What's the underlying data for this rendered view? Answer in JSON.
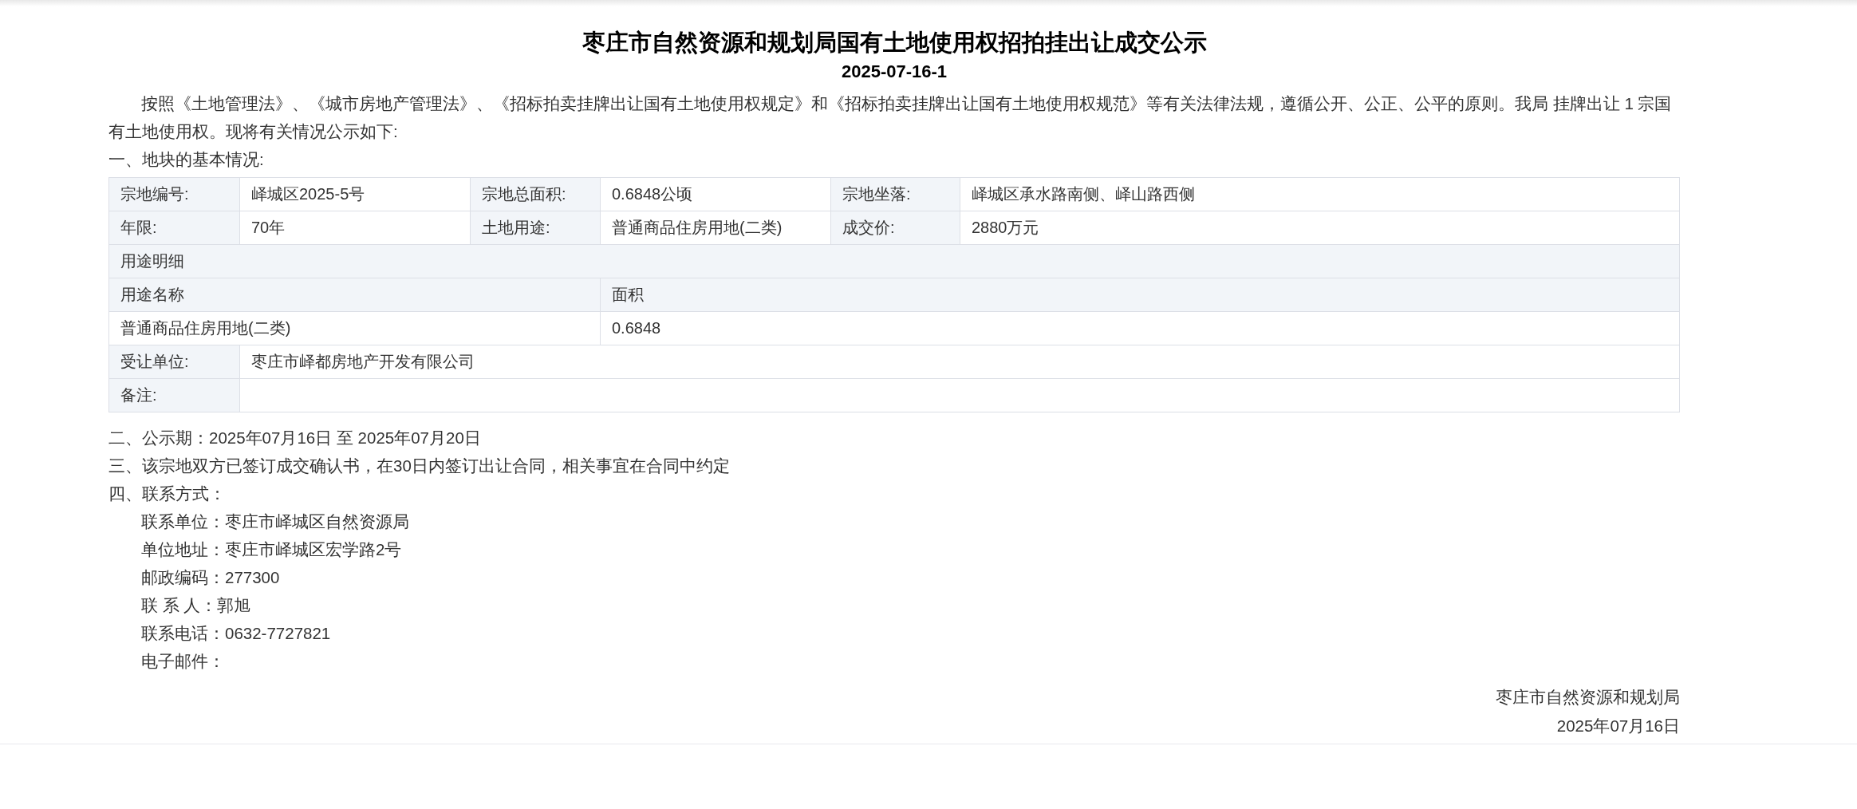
{
  "title": "枣庄市自然资源和规划局国有土地使用权招拍挂出让成交公示",
  "serial": "2025-07-16-1",
  "intro": "按照《土地管理法》、《城市房地产管理法》、《招标拍卖挂牌出让国有土地使用权规定》和《招标拍卖挂牌出让国有土地使用权规范》等有关法律法规，遵循公开、公正、公平的原则。我局 挂牌出让 1 宗国有土地使用权。现将有关情况公示如下:",
  "section_1": "一、地块的基本情况:",
  "table": {
    "rows": [
      {
        "kind": "fields",
        "cells": [
          {
            "label": "宗地编号:",
            "value": "峄城区2025-5号"
          },
          {
            "label": "宗地总面积:",
            "value": "0.6848公顷"
          },
          {
            "label": "宗地坐落:",
            "value": "峄城区承水路南侧、峄山路西侧"
          }
        ]
      },
      {
        "kind": "fields",
        "cells": [
          {
            "label": "年限:",
            "value": "70年"
          },
          {
            "label": "土地用途:",
            "value": "普通商品住房用地(二类)"
          },
          {
            "label": "成交价:",
            "value": "2880万元"
          }
        ]
      },
      {
        "kind": "heading",
        "text": "用途明细"
      },
      {
        "kind": "subheader",
        "cells": [
          "用途名称",
          "面积"
        ]
      },
      {
        "kind": "usage",
        "cells": [
          "普通商品住房用地(二类)",
          "0.6848"
        ]
      },
      {
        "kind": "wide",
        "label": "受让单位:",
        "value": "枣庄市峄都房地产开发有限公司"
      },
      {
        "kind": "wide",
        "label": "备注:"
      }
    ]
  },
  "sections": [
    "二、公示期：2025年07月16日 至 2025年07月20日",
    "三、该宗地双方已签订成交确认书，在30日内签订出让合同，相关事宜在合同中约定",
    "四、联系方式："
  ],
  "contacts": [
    "联系单位：枣庄市峄城区自然资源局",
    "单位地址：枣庄市峄城区宏学路2号",
    "邮政编码：277300",
    "联 系 人：郭旭",
    "联系电话：0632-7727821",
    "电子邮件："
  ],
  "signature": {
    "issuer": "枣庄市自然资源和规划局",
    "date": "2025年07月16日"
  }
}
